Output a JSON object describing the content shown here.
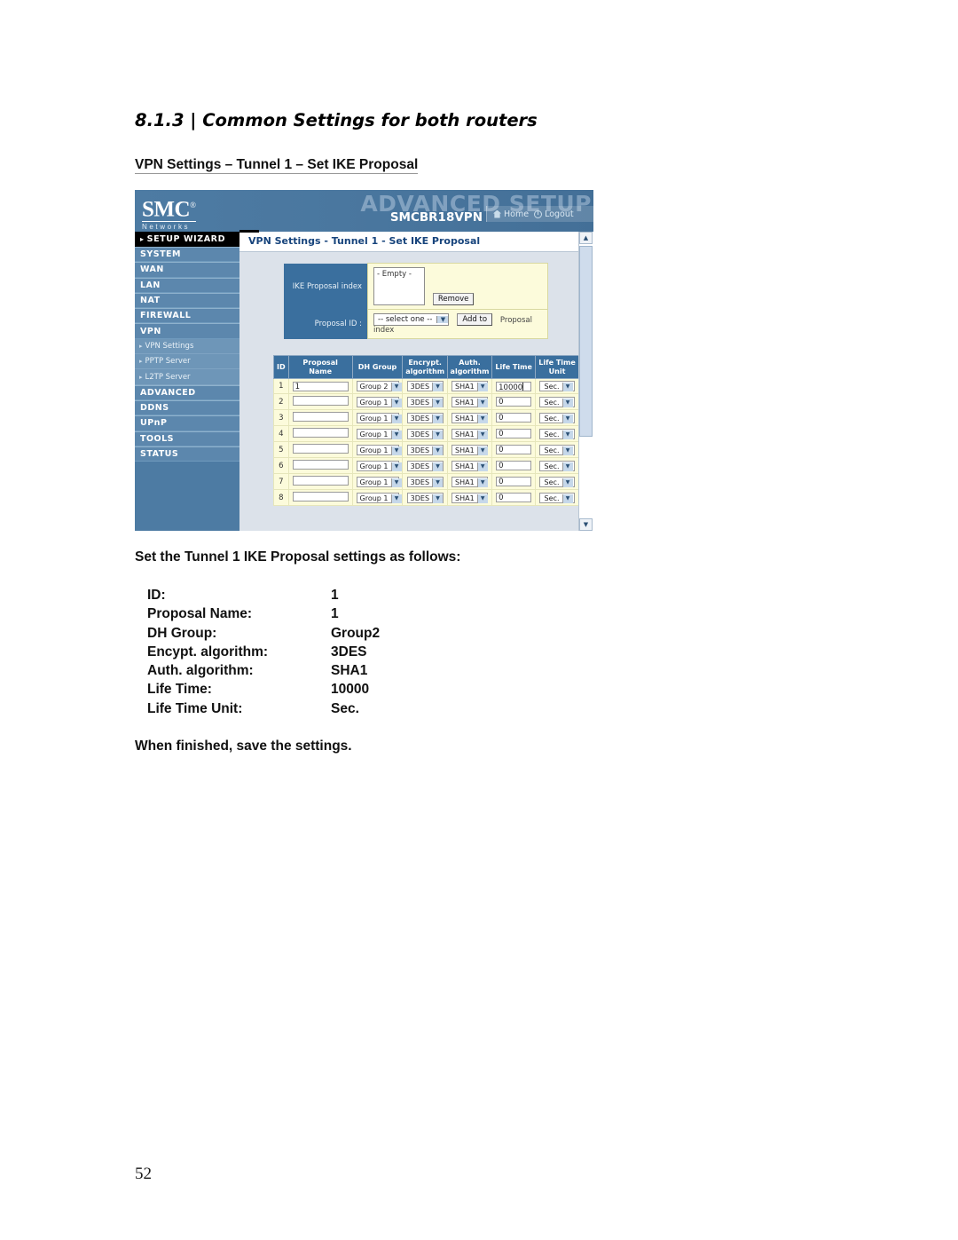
{
  "document": {
    "heading": "8.1.3 | Common Settings for both routers",
    "subheading": "VPN Settings – Tunnel 1 – Set IKE Proposal",
    "intro_line": "Set the Tunnel 1 IKE Proposal settings as follows:",
    "closing_line": "When finished, save the settings.",
    "page_number": "52",
    "settings": [
      {
        "key": "ID:",
        "value": "1"
      },
      {
        "key": "Proposal Name:",
        "value": "1"
      },
      {
        "key": "DH Group:",
        "value": "Group2"
      },
      {
        "key": "Encypt. algorithm:",
        "value": "3DES"
      },
      {
        "key": "Auth. algorithm:",
        "value": "SHA1"
      },
      {
        "key": "Life Time:",
        "value": "10000"
      },
      {
        "key": "Life Time Unit:",
        "value": "Sec."
      }
    ]
  },
  "screenshot": {
    "banner": {
      "logo_text": "SMC",
      "logo_reg": "®",
      "logo_sub": "Networks",
      "watermark": "ADVANCED SETUP",
      "model": "SMCBR18VPN",
      "nav": [
        {
          "label": "Home",
          "icon": "home-icon"
        },
        {
          "label": "Logout",
          "icon": "logout-icon"
        }
      ]
    },
    "sidebar": {
      "wizard": "SETUP WIZARD",
      "items": [
        {
          "label": "SYSTEM",
          "type": "main"
        },
        {
          "label": "WAN",
          "type": "main"
        },
        {
          "label": "LAN",
          "type": "main"
        },
        {
          "label": "NAT",
          "type": "main"
        },
        {
          "label": "FIREWALL",
          "type": "main"
        },
        {
          "label": "VPN",
          "type": "main"
        },
        {
          "label": "VPN Settings",
          "type": "sub"
        },
        {
          "label": "PPTP Server",
          "type": "sub"
        },
        {
          "label": "L2TP Server",
          "type": "sub"
        },
        {
          "label": "ADVANCED",
          "type": "main"
        },
        {
          "label": "DDNS",
          "type": "main"
        },
        {
          "label": "UPnP",
          "type": "main"
        },
        {
          "label": "TOOLS",
          "type": "main"
        },
        {
          "label": "STATUS",
          "type": "main"
        }
      ]
    },
    "content": {
      "title": "VPN Settings - Tunnel 1 - Set IKE Proposal",
      "panel": {
        "index_label": "IKE Proposal index",
        "index_value": "- Empty -",
        "remove_button": "Remove",
        "proposal_id_label": "Proposal ID :",
        "proposal_id_value": "-- select one --",
        "add_button": "Add to",
        "add_suffix": "Proposal index"
      },
      "table": {
        "headers": [
          "ID",
          "Proposal Name",
          "DH Group",
          "Encrypt. algorithm",
          "Auth. algorithm",
          "Life Time",
          "Life Time Unit"
        ],
        "rows": [
          {
            "id": "1",
            "name": "1",
            "dh": "Group 2",
            "enc": "3DES",
            "auth": "SHA1",
            "life": "10000",
            "unit": "Sec.",
            "focused": true
          },
          {
            "id": "2",
            "name": "",
            "dh": "Group 1",
            "enc": "3DES",
            "auth": "SHA1",
            "life": "0",
            "unit": "Sec.",
            "focused": false
          },
          {
            "id": "3",
            "name": "",
            "dh": "Group 1",
            "enc": "3DES",
            "auth": "SHA1",
            "life": "0",
            "unit": "Sec.",
            "focused": false
          },
          {
            "id": "4",
            "name": "",
            "dh": "Group 1",
            "enc": "3DES",
            "auth": "SHA1",
            "life": "0",
            "unit": "Sec.",
            "focused": false
          },
          {
            "id": "5",
            "name": "",
            "dh": "Group 1",
            "enc": "3DES",
            "auth": "SHA1",
            "life": "0",
            "unit": "Sec.",
            "focused": false
          },
          {
            "id": "6",
            "name": "",
            "dh": "Group 1",
            "enc": "3DES",
            "auth": "SHA1",
            "life": "0",
            "unit": "Sec.",
            "focused": false
          },
          {
            "id": "7",
            "name": "",
            "dh": "Group 1",
            "enc": "3DES",
            "auth": "SHA1",
            "life": "0",
            "unit": "Sec.",
            "focused": false
          },
          {
            "id": "8",
            "name": "",
            "dh": "Group 1",
            "enc": "3DES",
            "auth": "SHA1",
            "life": "0",
            "unit": "Sec.",
            "focused": false
          }
        ]
      }
    },
    "scrollbar": {
      "up": "▲",
      "down": "▼"
    }
  },
  "colors": {
    "banner_blue": "#4d7ba3",
    "header_blue": "#3a6f9e",
    "content_bg": "#dce2ea",
    "field_yellow": "#fcfbdb",
    "title_text": "#17447c"
  }
}
